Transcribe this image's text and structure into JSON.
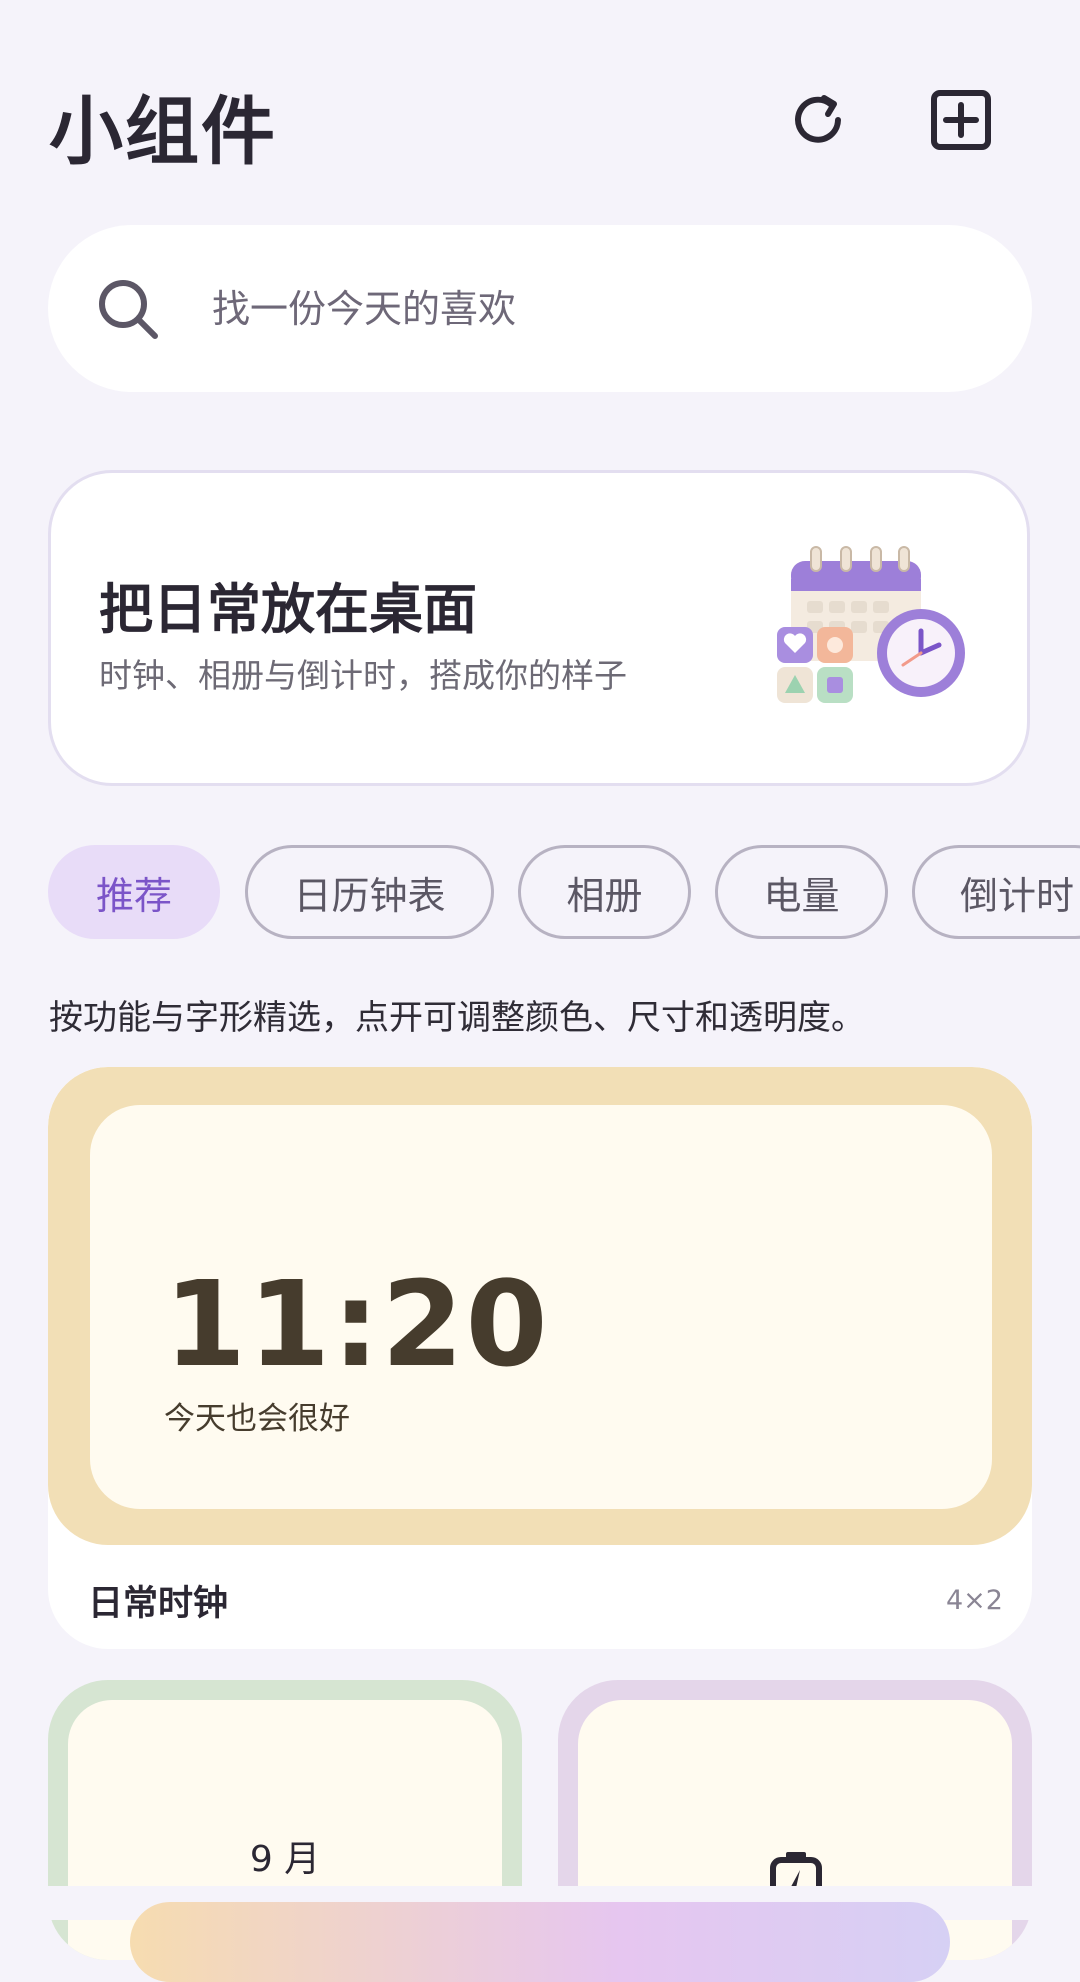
{
  "header": {
    "title": "小组件"
  },
  "search": {
    "placeholder": "找一份今天的喜欢"
  },
  "banner": {
    "title": "把日常放在桌面",
    "subtitle": "时钟、相册与倒计时，搭成你的样子"
  },
  "chips": [
    {
      "label": "推荐",
      "active": true
    },
    {
      "label": "日历钟表"
    },
    {
      "label": "相册"
    },
    {
      "label": "电量"
    },
    {
      "label": "倒计时"
    }
  ],
  "description": "按功能与字形精选，点开可调整颜色、尺寸和透明度。",
  "widgets": {
    "clock": {
      "time": "11:20",
      "message": "今天也会很好",
      "name": "日常时钟",
      "size": "4×2"
    },
    "calendar": {
      "month": "9 月"
    },
    "battery": {}
  },
  "colors": {
    "accent": "#7b55c8",
    "background": "#f5f3fa",
    "clock_frame": "#f2dfb6",
    "calendar_frame": "#d6e5d2",
    "battery_frame": "#e4d6ea"
  }
}
